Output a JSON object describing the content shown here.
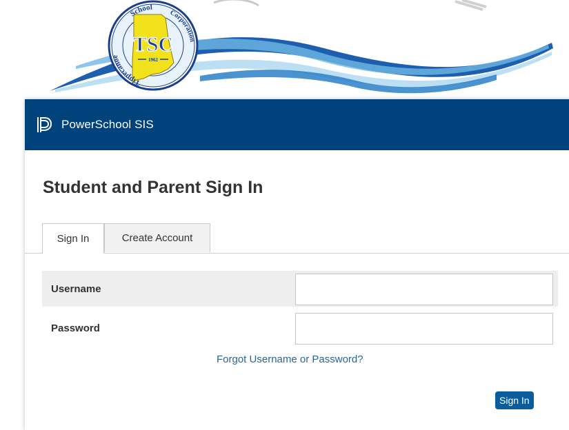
{
  "header": {
    "seal": {
      "arc_left": "Tippecanoe",
      "arc_top": "School",
      "arc_right": "Corporation",
      "center": "TSC",
      "year": "1962"
    }
  },
  "topbar": {
    "brand": "PowerSchool SIS",
    "logo_icon": "powerschool-logo-icon"
  },
  "page": {
    "title": "Student and Parent Sign In"
  },
  "tabs": [
    {
      "label": "Sign In",
      "active": true
    },
    {
      "label": "Create Account",
      "active": false
    }
  ],
  "form": {
    "username_label": "Username",
    "username_value": "",
    "password_label": "Password",
    "password_value": "",
    "forgot_link": "Forgot Username or Password?",
    "submit_label": "Sign In"
  },
  "colors": {
    "topbar": "#00427c",
    "button": "#0a5d9d",
    "link": "#2a6496",
    "seal_yellow": "#f2e21b",
    "swoosh_blue": "#1d5fae"
  }
}
